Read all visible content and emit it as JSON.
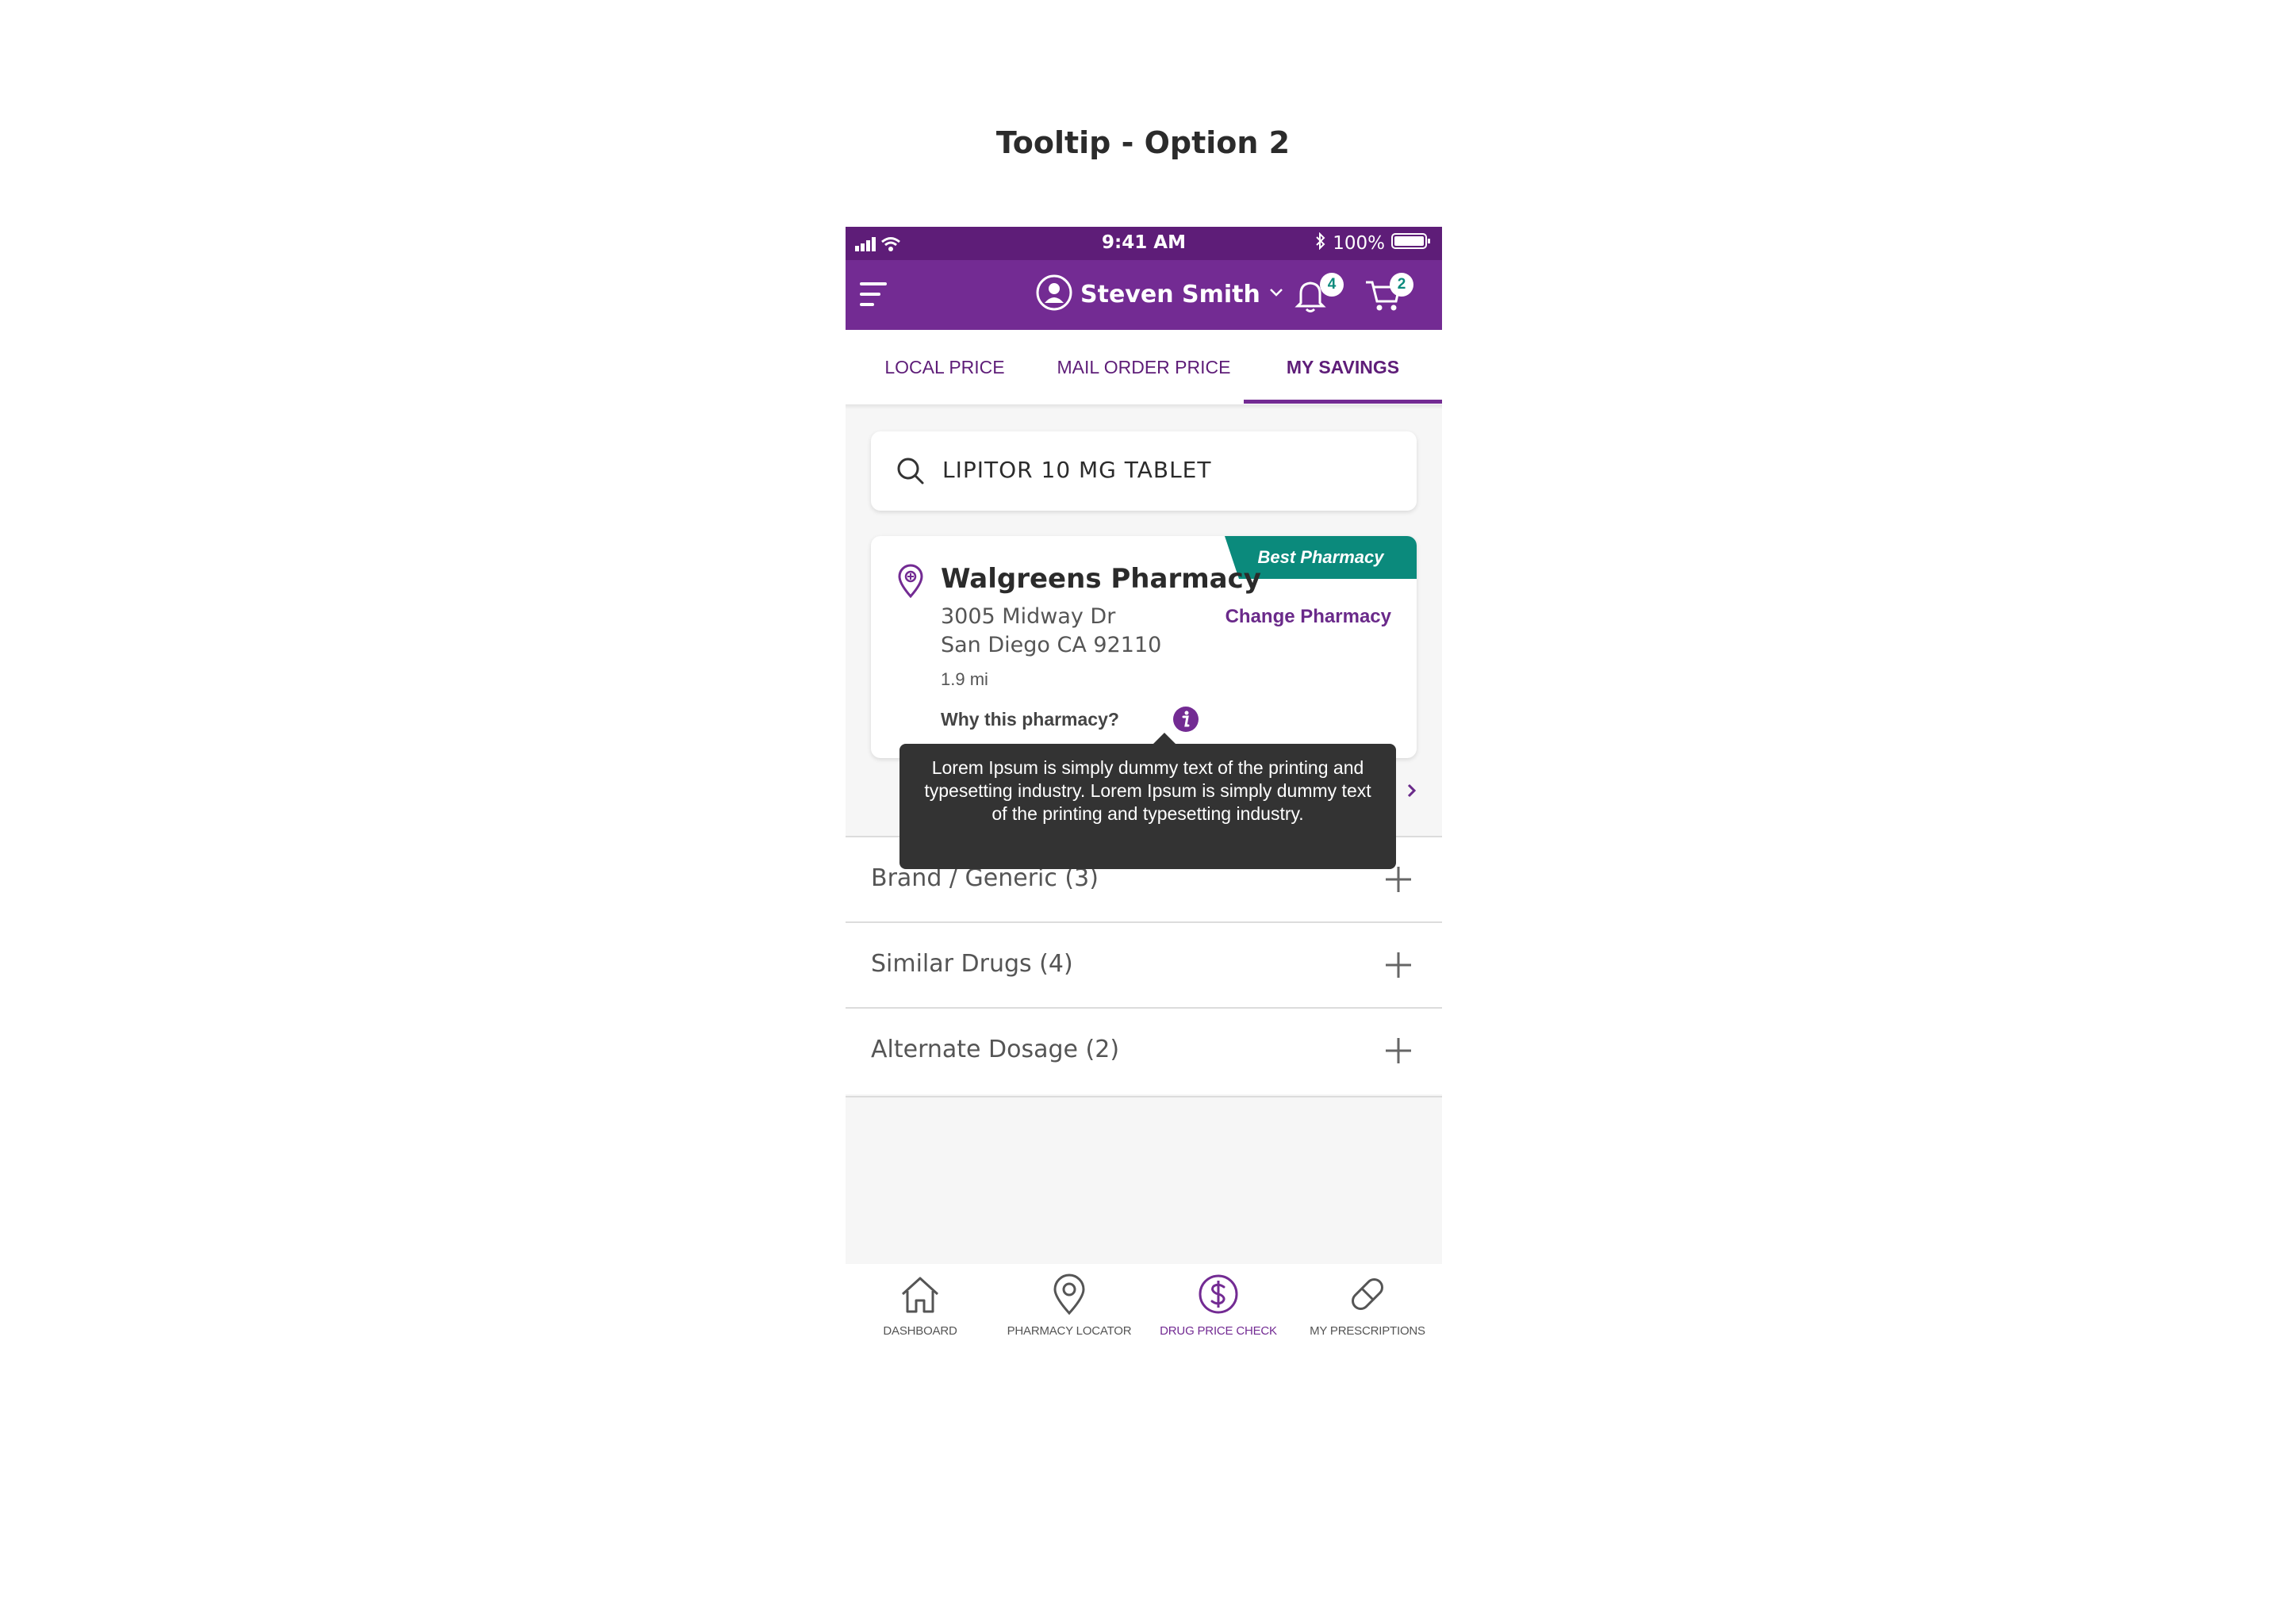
{
  "page_title": "Tooltip - Option 2",
  "status_bar": {
    "time": "9:41 AM",
    "battery": "100%"
  },
  "header": {
    "user_name": "Steven Smith",
    "notifications_count": "4",
    "cart_count": "2"
  },
  "tabs": [
    {
      "label": "LOCAL PRICE",
      "active": false
    },
    {
      "label": "MAIL ORDER PRICE",
      "active": false
    },
    {
      "label": "MY SAVINGS",
      "active": true
    }
  ],
  "search": {
    "value": "LIPITOR 10 MG TABLET"
  },
  "pharmacy": {
    "ribbon": "Best Pharmacy",
    "name": "Walgreens Pharmacy",
    "address_line1": "3005 Midway Dr",
    "address_line2": "San Diego CA 92110",
    "distance": "1.9 mi",
    "change_label": "Change Pharmacy",
    "why_label": "Why this pharmacy?"
  },
  "tooltip": {
    "text": "Lorem Ipsum is simply dummy text of the printing and typesetting industry. Lorem Ipsum is simply dummy text of the printing and typesetting industry."
  },
  "accordion": [
    {
      "label": "Brand / Generic (3)"
    },
    {
      "label": "Similar Drugs (4)"
    },
    {
      "label": "Alternate Dosage (2)"
    }
  ],
  "bottom_nav": [
    {
      "label": "DASHBOARD",
      "icon": "home-icon",
      "active": false
    },
    {
      "label": "PHARMACY LOCATOR",
      "icon": "location-pin-icon",
      "active": false
    },
    {
      "label": "DRUG PRICE CHECK",
      "icon": "dollar-circle-icon",
      "active": true
    },
    {
      "label": "MY PRESCRIPTIONS",
      "icon": "pill-icon",
      "active": false
    }
  ],
  "colors": {
    "brand_purple": "#732b93",
    "status_purple": "#5e1d78",
    "accent_teal": "#0b8a7c",
    "tooltip_bg": "#333333"
  }
}
